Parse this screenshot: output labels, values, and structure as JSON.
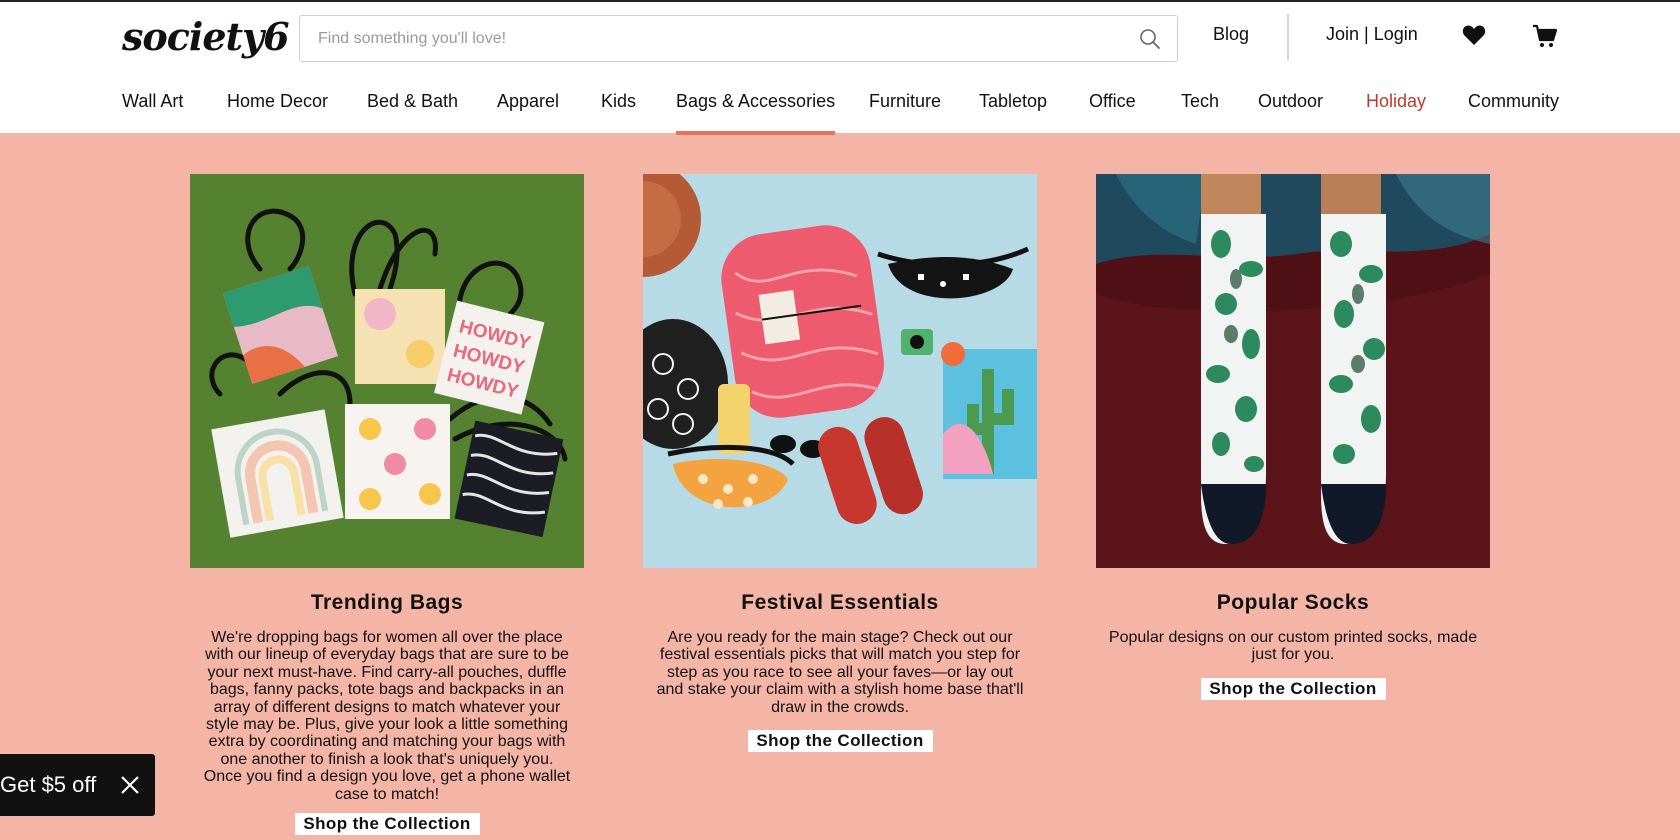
{
  "header": {
    "logo": "society6",
    "search_placeholder": "Find something you'll love!",
    "blog": "Blog",
    "login": "Join | Login"
  },
  "nav": {
    "items": [
      {
        "label": "Wall Art"
      },
      {
        "label": "Home Decor"
      },
      {
        "label": "Bed & Bath"
      },
      {
        "label": "Apparel"
      },
      {
        "label": "Kids"
      },
      {
        "label": "Bags & Accessories",
        "active": true
      },
      {
        "label": "Furniture"
      },
      {
        "label": "Tabletop"
      },
      {
        "label": "Office"
      },
      {
        "label": "Tech"
      },
      {
        "label": "Outdoor"
      },
      {
        "label": "Holiday",
        "highlight": true
      },
      {
        "label": "Community"
      }
    ]
  },
  "cards": [
    {
      "title": "Trending Bags",
      "description": "We're dropping bags for women all over the place with our lineup of everyday bags that are sure to be your next must-have. Find carry-all pouches, duffle bags, fanny packs, tote bags and backpacks in an array of different designs to match whatever your style may be. Plus, give your look a little something extra by coordinating and matching your bags with one another to finish a look that's uniquely you. Once you find a design you love, get a phone wallet case to match!",
      "cta": "Shop the Collection",
      "image_text": [
        "HOWDY",
        "HOWDY",
        "HOWDY"
      ]
    },
    {
      "title": "Festival Essentials",
      "description": "Are you ready for the main stage? Check out our festival essentials picks that will match you step for step as you race to see all your faves—or lay out and stake your claim with a stylish home base that'll draw in the crowds.",
      "cta": "Shop the Collection"
    },
    {
      "title": "Popular Socks",
      "description": "Popular designs on our custom printed socks, made just for you.",
      "cta": "Shop the Collection"
    }
  ],
  "promo": {
    "label": "Get $5 off"
  },
  "colors": {
    "page_background": "#f5b5a6",
    "active_underline": "#e4735c",
    "holiday": "#c0392b",
    "promo_background": "#111111"
  }
}
